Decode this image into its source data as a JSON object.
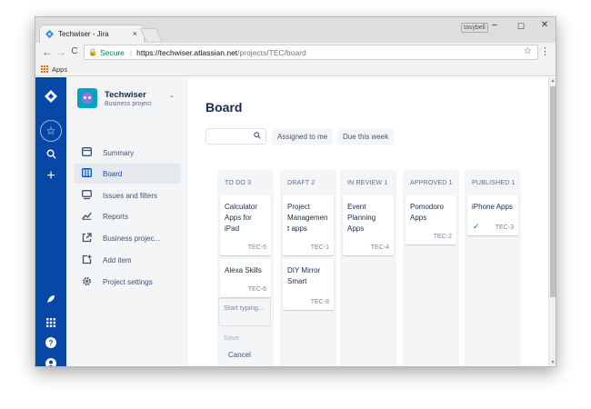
{
  "browser": {
    "tab_title": "Techwiser - Jira",
    "tab_close": "×",
    "user_badge": "tasybell",
    "window_controls": {
      "minimize": "−",
      "maximize": "☐",
      "close": "✕"
    },
    "nav": {
      "back": "←",
      "forward": "→",
      "reload": "C"
    },
    "address": {
      "secure_label": "Secure",
      "separator": "|",
      "url_host": "https://techwiser.atlassian.net",
      "url_path": "/projects/TEC/board"
    },
    "bookmark_star": "☆",
    "menu": "⋮",
    "bookmarks": {
      "apps_label": "Apps"
    }
  },
  "global_nav": {
    "icons": [
      "jira-logo-icon",
      "starred-icon",
      "search-icon",
      "create-icon",
      "rocket-icon",
      "app-switcher-icon",
      "help-icon",
      "profile-icon"
    ]
  },
  "project": {
    "name": "Techwiser",
    "type": "Business project",
    "chevron": "⌄"
  },
  "sidebar": {
    "items": [
      {
        "label": "Summary",
        "icon": "summary-icon"
      },
      {
        "label": "Board",
        "icon": "board-icon",
        "active": true
      },
      {
        "label": "Issues and filters",
        "icon": "issues-icon"
      },
      {
        "label": "Reports",
        "icon": "reports-icon"
      },
      {
        "label": "Business projec...",
        "icon": "external-link-icon"
      },
      {
        "label": "Add item",
        "icon": "add-item-icon"
      },
      {
        "label": "Project settings",
        "icon": "settings-icon"
      }
    ]
  },
  "board": {
    "title": "Board",
    "search_placeholder": "",
    "filters": [
      "Assigned to me",
      "Due this week"
    ],
    "columns": [
      {
        "header": "TO DO 3",
        "cards": [
          {
            "title": "Calculator Apps for iPad",
            "key": "TEC-5"
          },
          {
            "title": "Alexa Skills",
            "key": "TEC-6"
          }
        ]
      },
      {
        "header": "DRAFT 2",
        "cards": [
          {
            "title": "Project Managemen t apps",
            "key": "TEC-1"
          },
          {
            "title": "DIY Mirror Smart",
            "key": "TEC-8"
          }
        ]
      },
      {
        "header": "IN REVIEW 1",
        "cards": [
          {
            "title": "Event Planning Apps",
            "key": "TEC-4"
          }
        ]
      },
      {
        "header": "APPROVED 1",
        "cards": [
          {
            "title": "Pomodoro Apps",
            "key": "TEC-2"
          }
        ]
      },
      {
        "header": "PUBLISHED 1",
        "cards": [
          {
            "title": "iPhone Apps",
            "key": "TEC-3",
            "done": true
          }
        ]
      }
    ],
    "create_placeholder": "Start typing...",
    "save_label": "Save",
    "cancel_label": "Cancel"
  },
  "colors": {
    "global_nav": "#0747a6",
    "sidebar": "#f4f5f7",
    "active_link": "#0052cc",
    "done_check": "#00875a"
  }
}
